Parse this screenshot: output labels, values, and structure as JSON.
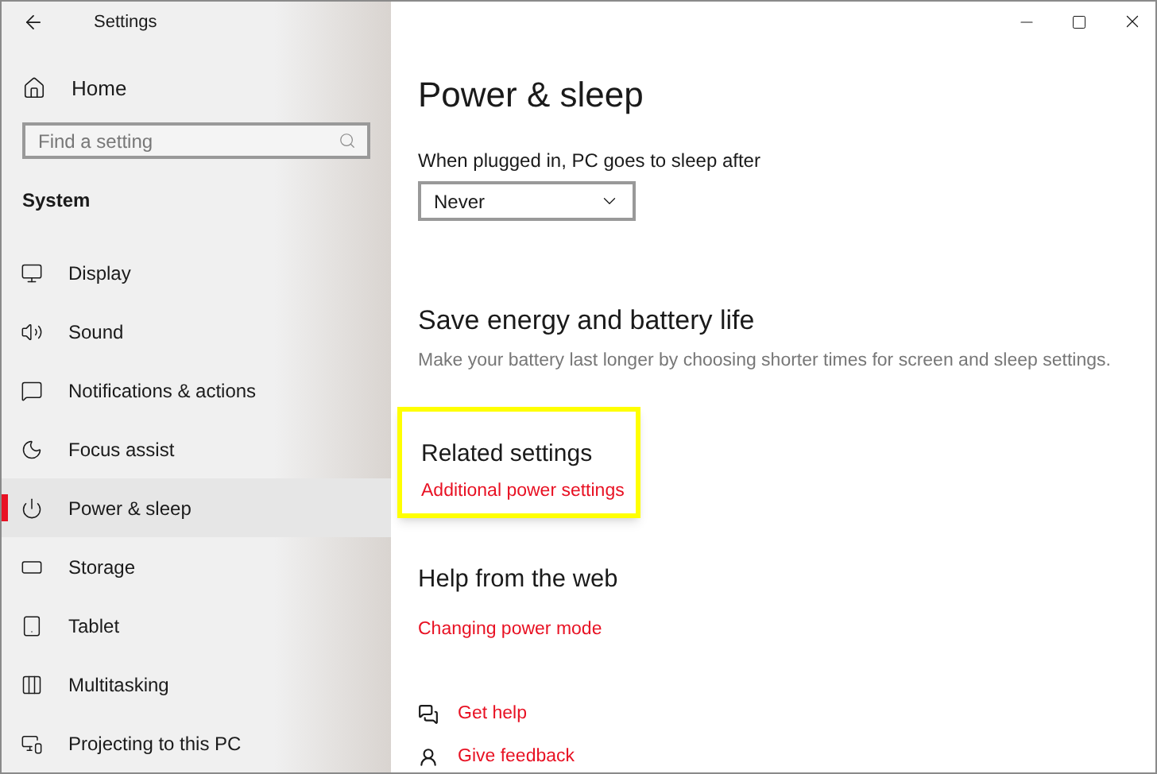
{
  "window": {
    "title": "Settings"
  },
  "sidebar": {
    "home": "Home",
    "search": {
      "placeholder": "Find a setting"
    },
    "section": "System",
    "items": [
      {
        "label": "Display",
        "selected": false
      },
      {
        "label": "Sound",
        "selected": false
      },
      {
        "label": "Notifications & actions",
        "selected": false
      },
      {
        "label": "Focus assist",
        "selected": false
      },
      {
        "label": "Power & sleep",
        "selected": true
      },
      {
        "label": "Storage",
        "selected": false
      },
      {
        "label": "Tablet",
        "selected": false
      },
      {
        "label": "Multitasking",
        "selected": false
      },
      {
        "label": "Projecting to this PC",
        "selected": false
      }
    ]
  },
  "page": {
    "title": "Power & sleep",
    "sleep": {
      "label": "When plugged in, PC goes to sleep after",
      "value": "Never"
    },
    "save_energy": {
      "heading": "Save energy and battery life",
      "description": "Make your battery last longer by choosing shorter times for screen and sleep settings."
    },
    "related_settings": {
      "heading": "Related settings",
      "link": "Additional power settings",
      "highlighted": true
    },
    "help_from_web": {
      "heading": "Help from the web",
      "link": "Changing power mode"
    },
    "footer_links": [
      {
        "label": "Get help"
      },
      {
        "label": "Give feedback"
      }
    ]
  }
}
